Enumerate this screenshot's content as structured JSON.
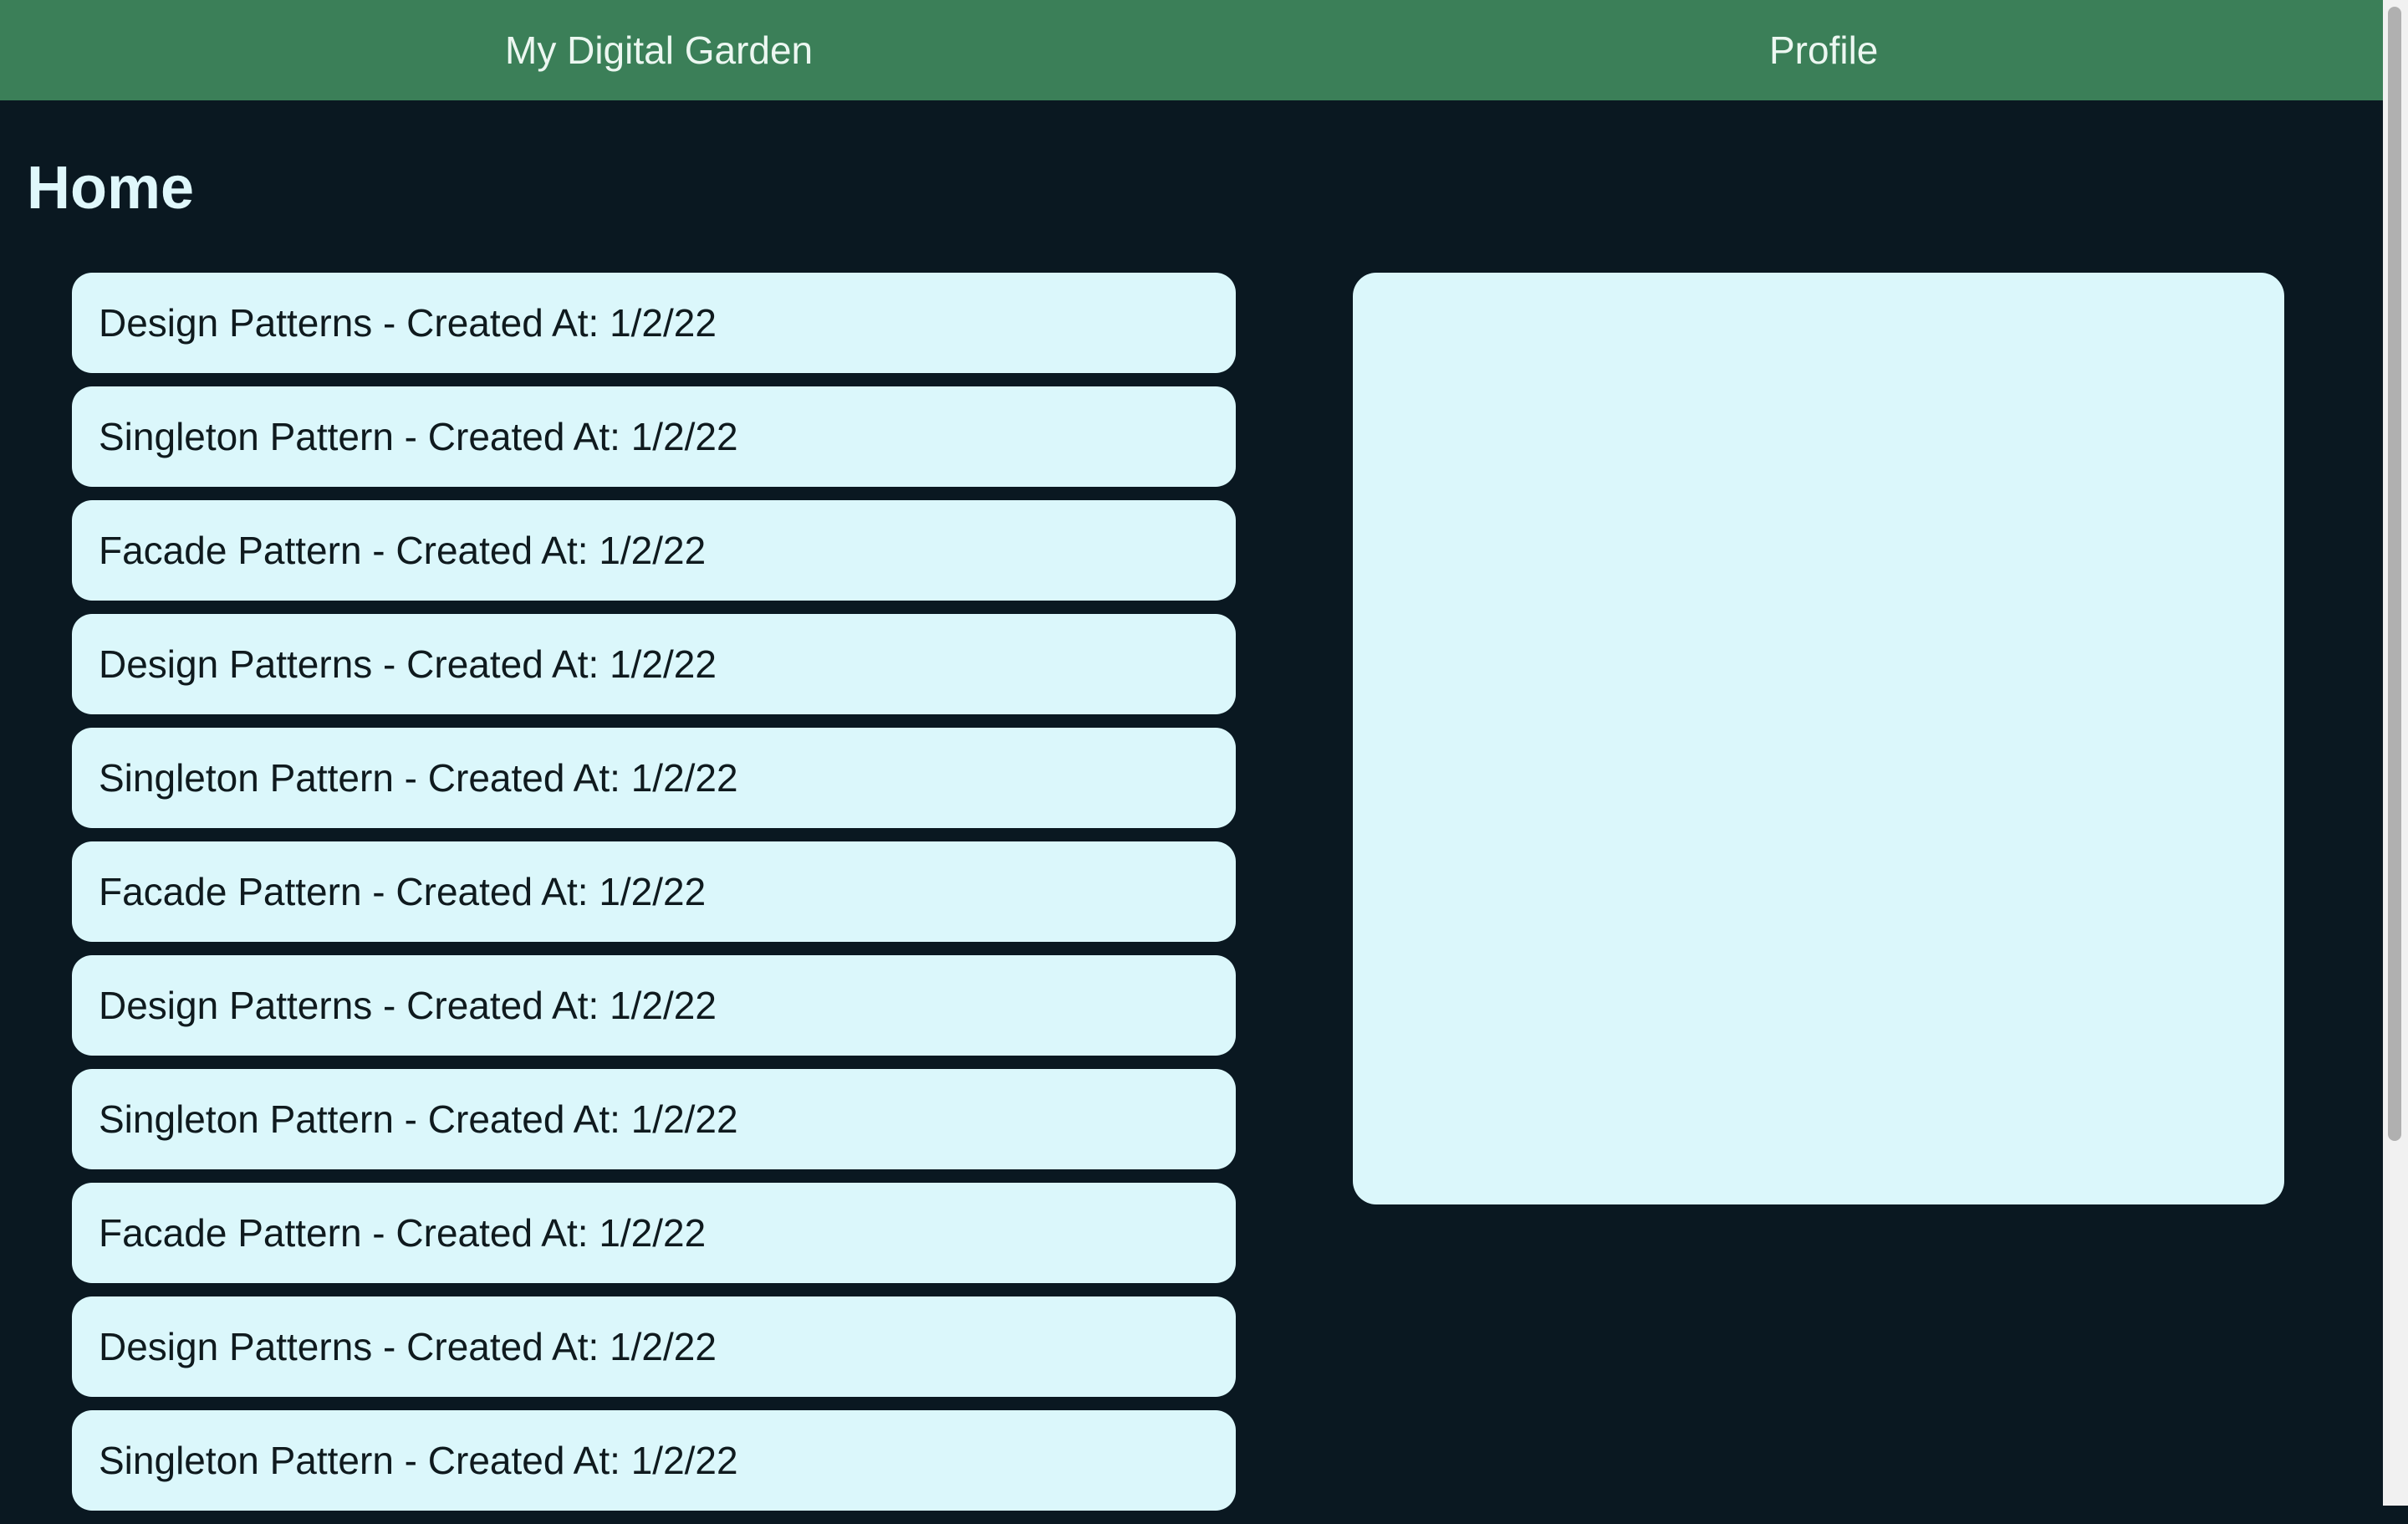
{
  "nav": {
    "home_label": "My Digital Garden",
    "profile_label": "Profile"
  },
  "page": {
    "title": "Home"
  },
  "posts": [
    {
      "label": "Design Patterns - Created At: 1/2/22"
    },
    {
      "label": "Singleton Pattern - Created At: 1/2/22"
    },
    {
      "label": "Facade Pattern - Created At: 1/2/22"
    },
    {
      "label": "Design Patterns - Created At: 1/2/22"
    },
    {
      "label": "Singleton Pattern - Created At: 1/2/22"
    },
    {
      "label": "Facade Pattern - Created At: 1/2/22"
    },
    {
      "label": "Design Patterns - Created At: 1/2/22"
    },
    {
      "label": "Singleton Pattern - Created At: 1/2/22"
    },
    {
      "label": "Facade Pattern - Created At: 1/2/22"
    },
    {
      "label": "Design Patterns - Created At: 1/2/22"
    },
    {
      "label": "Singleton Pattern - Created At: 1/2/22"
    }
  ],
  "colors": {
    "navbar": "#3b7f58",
    "background": "#0a1821",
    "card": "#dbf7fb",
    "title_text": "#dff7fb"
  }
}
